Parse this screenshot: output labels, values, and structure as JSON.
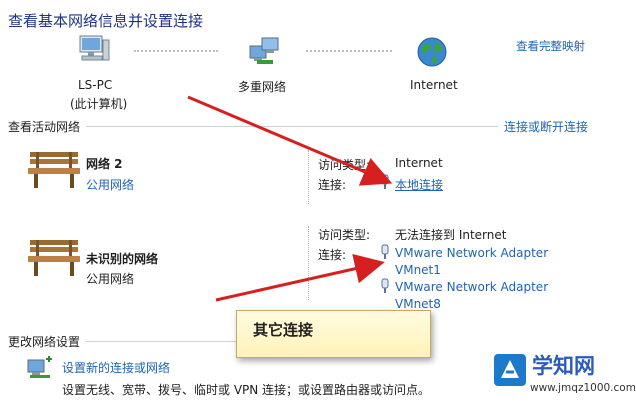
{
  "header": {
    "title": "查看基本网络信息并设置连接",
    "full_map_link": "查看完整映射"
  },
  "map": {
    "pc_name": "LS-PC",
    "pc_sub": "(此计算机)",
    "multi_network": "多重网络",
    "internet": "Internet"
  },
  "active": {
    "section_title": "查看活动网络",
    "connect_link": "连接或断开连接",
    "networks": [
      {
        "name": "网络  2",
        "type": "公用网络",
        "access_label": "访问类型:",
        "access_value": "Internet",
        "conn_label": "连接:",
        "connections": [
          "本地连接"
        ]
      },
      {
        "name": "未识别的网络",
        "type": "公用网络",
        "access_label": "访问类型:",
        "access_value": "无法连接到 Internet",
        "conn_label": "连接:",
        "connections": [
          "VMware Network Adapter",
          "VMnet1",
          "VMware Network Adapter",
          "VMnet8"
        ]
      }
    ]
  },
  "settings": {
    "section_title": "更改网络设置",
    "new_conn_link": "设置新的连接或网络",
    "new_conn_desc": "设置无线、宽带、拨号、临时或 VPN 连接；或设置路由器或访问点。"
  },
  "callout": {
    "text": "其它连接"
  },
  "watermark": {
    "brand": "学知网",
    "url": "www.jmqz1000.com"
  },
  "colors": {
    "link": "#1e64b4",
    "title": "#1e3287",
    "arrow": "#d62020"
  }
}
